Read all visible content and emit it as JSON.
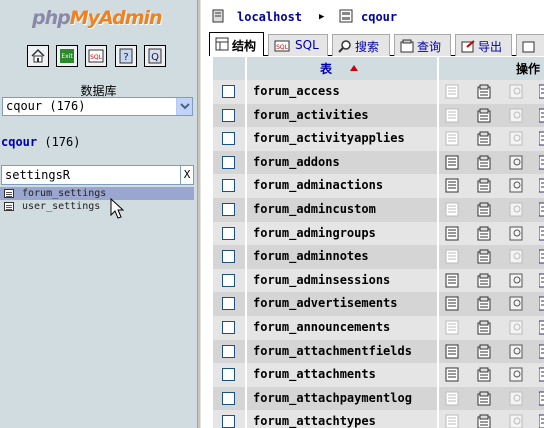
{
  "logo": {
    "part1": "php",
    "part2": "MyAdmin"
  },
  "sidebar": {
    "db_label": "数据库",
    "db_select_value": "cqour (176)",
    "db_title_name": "cqour",
    "db_title_count": "(176)",
    "filter_value": "settingsR",
    "filter_clear": "X",
    "tables": [
      {
        "label": "forum_settings",
        "highlighted": true
      },
      {
        "label": "user_settings",
        "highlighted": false
      }
    ],
    "quick_icons": [
      "home-icon",
      "exit-icon",
      "sql-query-icon",
      "docs-icon",
      "help-icon"
    ]
  },
  "breadcrumb": {
    "server": "localhost",
    "database": "cqour"
  },
  "tabs": [
    {
      "label": "结构",
      "icon": "structure-icon",
      "active": true
    },
    {
      "label": "SQL",
      "icon": "sql-icon",
      "active": false
    },
    {
      "label": "搜索",
      "icon": "search-icon",
      "active": false
    },
    {
      "label": "查询",
      "icon": "query-icon",
      "active": false
    },
    {
      "label": "导出",
      "icon": "export-icon",
      "active": false
    }
  ],
  "table": {
    "header_table": "表",
    "header_actions": "操作",
    "sort_direction": "ascending",
    "rows": [
      {
        "name": "forum_access",
        "browse_enabled": false
      },
      {
        "name": "forum_activities",
        "browse_enabled": false
      },
      {
        "name": "forum_activityapplies",
        "browse_enabled": false
      },
      {
        "name": "forum_addons",
        "browse_enabled": true
      },
      {
        "name": "forum_adminactions",
        "browse_enabled": true
      },
      {
        "name": "forum_admincustom",
        "browse_enabled": false
      },
      {
        "name": "forum_admingroups",
        "browse_enabled": true
      },
      {
        "name": "forum_adminnotes",
        "browse_enabled": false
      },
      {
        "name": "forum_adminsessions",
        "browse_enabled": true
      },
      {
        "name": "forum_advertisements",
        "browse_enabled": true
      },
      {
        "name": "forum_announcements",
        "browse_enabled": false
      },
      {
        "name": "forum_attachmentfields",
        "browse_enabled": true
      },
      {
        "name": "forum_attachments",
        "browse_enabled": true
      },
      {
        "name": "forum_attachpaymentlog",
        "browse_enabled": false
      },
      {
        "name": "forum_attachtypes",
        "browse_enabled": false
      }
    ]
  },
  "colors": {
    "sidebar_bg": "#d0dce0",
    "link_blue": "#0000aa",
    "row_odd": "#e5e5e5",
    "row_even": "#d5d5d5",
    "nav_highlight": "#9aa6cf",
    "logo_orange": "#f08020"
  }
}
